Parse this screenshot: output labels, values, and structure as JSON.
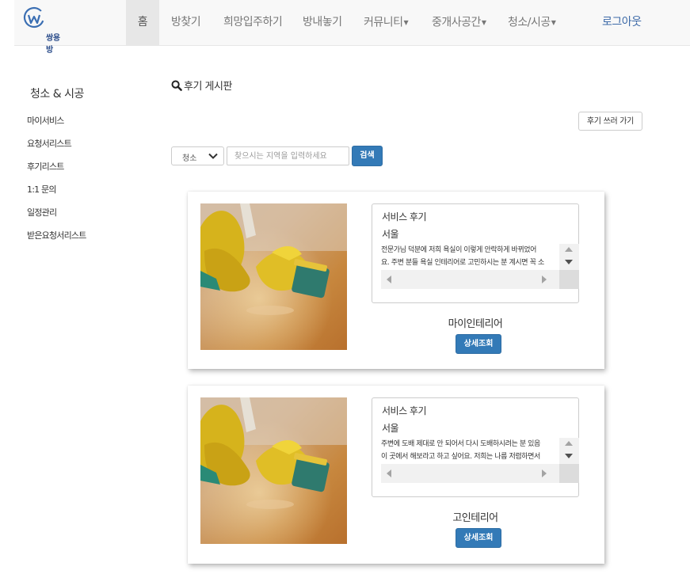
{
  "navbar": {
    "logo_text": "쌍용방",
    "items": [
      {
        "label": "홈"
      },
      {
        "label": "방찾기"
      },
      {
        "label": "희망입주하기"
      },
      {
        "label": "방내놓기"
      },
      {
        "label": "커뮤니티"
      },
      {
        "label": "중개사공간"
      },
      {
        "label": "청소/시공"
      },
      {
        "label": "로그아웃"
      }
    ]
  },
  "sidebar": {
    "title": "청소 & 시공",
    "items": [
      {
        "label": "마이서비스"
      },
      {
        "label": "요청서리스트"
      },
      {
        "label": "후기리스트"
      },
      {
        "label": "1:1 문의"
      },
      {
        "label": "일정관리"
      },
      {
        "label": "받은요청서리스트"
      }
    ]
  },
  "board": {
    "title": "후기 게시판",
    "write_label": "후기 쓰러 가기",
    "search": {
      "category": "청소",
      "placeholder": "찾으시는 지역을 입력하세요",
      "button_label": "검색"
    }
  },
  "reviews": [
    {
      "label": "서비스 후기",
      "region": "서울",
      "text_line1": "전문가님 덕분에 저희 욕실이 이렇게 안락하게 바뀌었어",
      "text_line2": "요. 주변 분들 욕실 인테리어로 고민하시는 분 계시면 꼭 소",
      "company": "마이인테리어",
      "button_label": "상세조회"
    },
    {
      "label": "서비스 후기",
      "region": "서울",
      "text_line1": "주변에 도배 제대로 안 되어서 다시 도배하시려는 분 있음",
      "text_line2": "이 곳에서 해보라고 하고 싶어요. 저희는 나름 저렴하면서",
      "company": "고인테리어",
      "button_label": "상세조회"
    }
  ],
  "colors": {
    "primary": "#337ab7",
    "navbar_bg": "#f8f8f8",
    "logout": "#3d6aa8"
  }
}
